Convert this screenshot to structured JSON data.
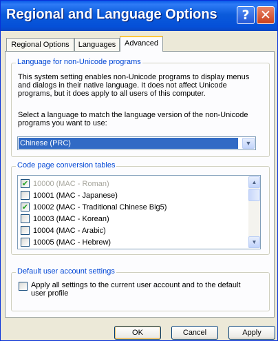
{
  "window": {
    "title": "Regional and Language Options",
    "help_label": "?",
    "close_label": "✕"
  },
  "tabs": [
    {
      "label": "Regional Options",
      "active": false
    },
    {
      "label": "Languages",
      "active": false
    },
    {
      "label": "Advanced",
      "active": true
    }
  ],
  "non_unicode": {
    "legend": "Language for non-Unicode programs",
    "desc_lines": [
      "This system setting enables non-Unicode programs to display menus",
      "and dialogs in their native language. It does not affect Unicode",
      "programs, but it does apply to all users of this computer."
    ],
    "select_lines": [
      "Select a language to match the language version of the non-Unicode",
      "programs you want to use:"
    ],
    "selected_language": "Chinese (PRC)",
    "dropdown_arrow": "▼"
  },
  "code_pages": {
    "legend": "Code page conversion tables",
    "items": [
      {
        "label": "10000 (MAC - Roman)",
        "checked": true,
        "disabled": true
      },
      {
        "label": "10001 (MAC - Japanese)",
        "checked": false,
        "disabled": false
      },
      {
        "label": "10002 (MAC - Traditional Chinese Big5)",
        "checked": true,
        "disabled": false
      },
      {
        "label": "10003 (MAC - Korean)",
        "checked": false,
        "disabled": false
      },
      {
        "label": "10004 (MAC - Arabic)",
        "checked": false,
        "disabled": false
      },
      {
        "label": "10005 (MAC - Hebrew)",
        "checked": false,
        "disabled": false
      }
    ],
    "scroll_up": "▲",
    "scroll_down": "▼"
  },
  "default_user": {
    "legend": "Default user account settings",
    "checkbox_lines": [
      "Apply all settings to the current user account and to the default",
      "user profile"
    ],
    "checked": false
  },
  "buttons": {
    "ok": "OK",
    "cancel": "Cancel",
    "apply": "Apply"
  },
  "colors": {
    "titlebar": "#0A5AE8",
    "legend": "#0046D5",
    "selection": "#316AC5",
    "check": "#21A121"
  }
}
